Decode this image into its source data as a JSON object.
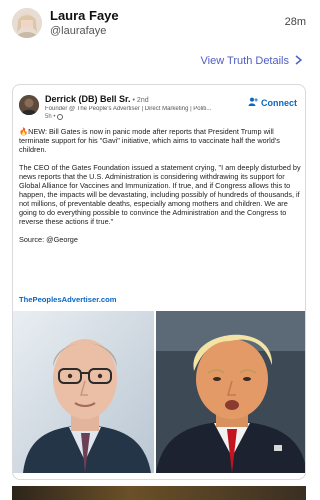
{
  "post": {
    "author_name": "Laura Faye",
    "author_handle": "@laurafaye",
    "timestamp": "28m",
    "view_details_label": "View Truth Details"
  },
  "quote": {
    "name": "Derrick (DB) Bell Sr.",
    "degree": "• 2nd",
    "headline": "Founder @ The People's Advertiser | Direct Marketing | Politi...",
    "time": "5h •",
    "connect_label": "Connect",
    "paragraph_1": "NEW: Bill Gates is now in panic mode after reports that President Trump will terminate support for his \"Gavi\" initiative, which aims to vaccinate half the world's children.",
    "paragraph_2": "The CEO of the Gates Foundation issued a statement crying, \"I am deeply disturbed by news reports that the U.S. Administration is considering withdrawing its support for Global Alliance for Vaccines and Immunization. If true, and if Congress allows this to happen, the impacts will be devastating, including possibly of hundreds of thousands, if not millions, of preventable deaths, especially among mothers and children. We are going to do everything possible to convince the Administration and the Congress to reverse these actions if true.\"",
    "source": "Source: @George",
    "link": "ThePeoplesAdvertiser.com"
  },
  "colors": {
    "accent": "#4f5ec2",
    "linkedin_blue": "#0a66c2"
  }
}
